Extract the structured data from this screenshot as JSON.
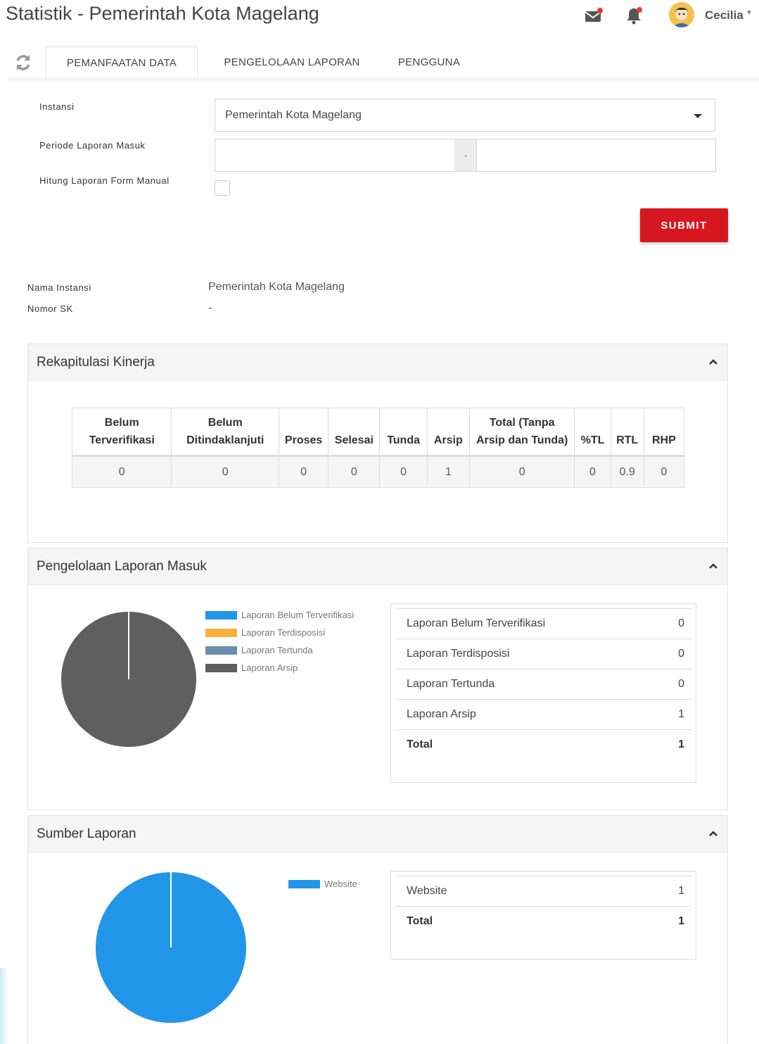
{
  "header": {
    "title": "Statistik - Pemerintah Kota Magelang",
    "user_name": "Cecilia"
  },
  "tabs": [
    {
      "label": "PEMANFAATAN DATA",
      "active": true
    },
    {
      "label": "PENGELOLAAN LAPORAN",
      "active": false
    },
    {
      "label": "PENGGUNA",
      "active": false
    }
  ],
  "filters": {
    "instansi_label": "Instansi",
    "instansi_value": "Pemerintah Kota Magelang",
    "periode_label": "Periode Laporan Masuk",
    "periode_start": "",
    "periode_separator": "-",
    "periode_end": "",
    "hitung_label": "Hitung Laporan Form Manual",
    "hitung_checked": false,
    "submit_label": "SUBMIT"
  },
  "info": {
    "nama_label": "Nama Instansi",
    "nama_value": "Pemerintah Kota Magelang",
    "sk_label": "Nomor SK",
    "sk_value": "-"
  },
  "rekap": {
    "title": "Rekapitulasi Kinerja",
    "headers": [
      "Belum Terverifikasi",
      "Belum Ditindaklanjuti",
      "Proses",
      "Selesai",
      "Tunda",
      "Arsip",
      "Total (Tanpa Arsip dan Tunda)",
      "%TL",
      "RTL",
      "RHP"
    ],
    "values": [
      "0",
      "0",
      "0",
      "0",
      "0",
      "1",
      "0",
      "0",
      "0.9",
      "0"
    ]
  },
  "pengelolaan": {
    "title": "Pengelolaan Laporan Masuk",
    "legend": [
      {
        "label": "Laporan Belum Terverifikasi",
        "color": "#2196e8"
      },
      {
        "label": "Laporan Terdisposisi",
        "color": "#f9b03f"
      },
      {
        "label": "Laporan Tertunda",
        "color": "#6a8eab"
      },
      {
        "label": "Laporan Arsip",
        "color": "#5f5f5f"
      }
    ],
    "rows": [
      {
        "label": "Laporan Belum Terverifikasi",
        "value": "0"
      },
      {
        "label": "Laporan Terdisposisi",
        "value": "0"
      },
      {
        "label": "Laporan Tertunda",
        "value": "0"
      },
      {
        "label": "Laporan Arsip",
        "value": "1"
      }
    ],
    "total_label": "Total",
    "total_value": "1"
  },
  "sumber": {
    "title": "Sumber Laporan",
    "legend": [
      {
        "label": "Website",
        "color": "#2196e8"
      }
    ],
    "rows": [
      {
        "label": "Website",
        "value": "1"
      }
    ],
    "total_label": "Total",
    "total_value": "1"
  },
  "chart_data": [
    {
      "type": "pie",
      "categories": [
        "Laporan Belum Terverifikasi",
        "Laporan Terdisposisi",
        "Laporan Tertunda",
        "Laporan Arsip"
      ],
      "values": [
        0,
        0,
        0,
        1
      ],
      "colors": [
        "#2196e8",
        "#f9b03f",
        "#6a8eab",
        "#5f5f5f"
      ],
      "legend": "right"
    },
    {
      "type": "pie",
      "categories": [
        "Website"
      ],
      "values": [
        1
      ],
      "colors": [
        "#2196e8"
      ],
      "legend": "top-right"
    }
  ],
  "icons": {
    "mail": "mail-icon",
    "bell": "bell-icon",
    "refresh": "refresh-icon",
    "collapse": "chevron-up-icon"
  },
  "colors": {
    "accent": "#d7171f",
    "panel_head": "#f5f5f5"
  }
}
